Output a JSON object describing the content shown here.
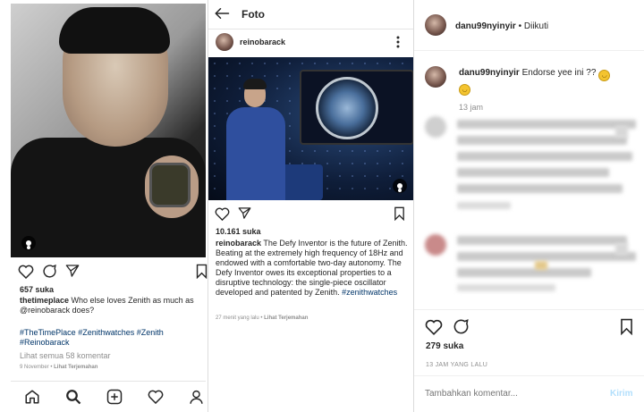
{
  "left_post": {
    "likes": "657 suka",
    "username": "thetimeplace",
    "caption": "Who else loves Zenith as much as @reinobarack does?",
    "hashtags": "#TheTimePlace #Zenithwatches #Zenith #Reinobarack",
    "view_comments": "Lihat semua 58 komentar",
    "date": "9 November",
    "translate": "Lihat Terjemahan"
  },
  "middle_post": {
    "screen_title": "Foto",
    "username": "reinobarack",
    "likes": "10.161 suka",
    "caption_user": "reinobarack",
    "caption": "The Defy Inventor is the future of Zenith. Beating at the extremely high frequency of 18Hz and endowed with a comfortable two-day autonomy. The Defy Inventor owes its exceptional properties to a disruptive technology: the single-piece oscillator developed and patented by Zenith.",
    "hashtag": "#zenithwatches",
    "time": "27 menit yang lalu",
    "translate": "Lihat Terjemahan"
  },
  "right_post": {
    "username": "danu99nyinyir",
    "follow_status": "Diikuti",
    "comment_user": "danu99nyinyir",
    "comment_text": "Endorse yee ini ??",
    "comment_time": "13 jam",
    "likes": "279 suka",
    "timestamp": "13 JAM YANG LALU",
    "comment_placeholder": "Tambahkan komentar...",
    "send_label": "Kirim"
  },
  "colors": {
    "link_blue": "#003569",
    "send_blue": "#b2dffc",
    "muted": "#8e8e8e"
  },
  "icons": [
    "heart-icon",
    "comment-icon",
    "share-icon",
    "bookmark-icon",
    "home-icon",
    "search-icon",
    "add-icon",
    "user-icon",
    "back-arrow-icon",
    "more-icon"
  ]
}
